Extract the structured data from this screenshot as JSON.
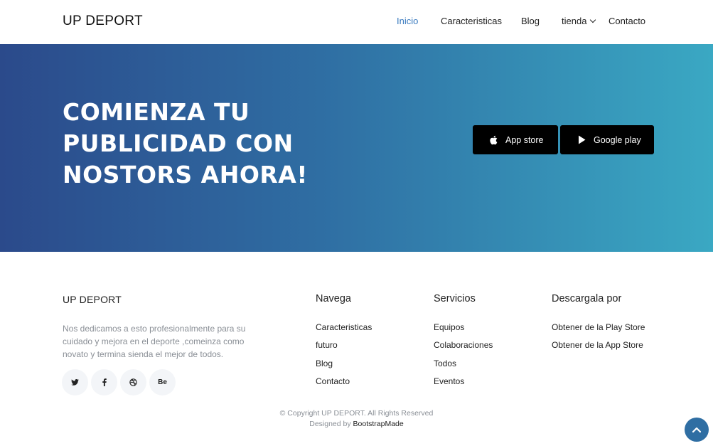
{
  "header": {
    "brand": "UP DEPORT",
    "nav": [
      {
        "label": "Inicio"
      },
      {
        "label": "Caracteristicas"
      },
      {
        "label": "Blog"
      },
      {
        "label": "tienda"
      },
      {
        "label": "Contacto"
      }
    ],
    "active_color": "#3b7bbf"
  },
  "hero": {
    "title": "COMIENZA TU PUBLICIDAD CON NOSTORS AHORA!",
    "buttons": {
      "app_store": {
        "label": "App store",
        "icon": "apple-icon"
      },
      "google_play": {
        "label": "Google play",
        "icon": "play-icon"
      }
    },
    "gradient": [
      "#2b4a8b",
      "#3aa8c3"
    ]
  },
  "footer": {
    "brand": "UP DEPORT",
    "description": "Nos dedicamos a esto profesionalmente para su cuidado y mejora en el deporte ,comeinza como novato y termina sienda el mejor de todos.",
    "socials": [
      {
        "icon": "twitter-icon"
      },
      {
        "icon": "facebook-icon"
      },
      {
        "icon": "dribbble-icon"
      },
      {
        "icon": "behance-icon",
        "text": "Be"
      }
    ],
    "columns": [
      {
        "title": "Navega",
        "items": [
          "Caracteristicas",
          "futuro",
          "Blog",
          "Contacto"
        ]
      },
      {
        "title": "Servicios",
        "items": [
          "Equipos",
          "Colaboraciones",
          "Todos",
          "Eventos"
        ]
      },
      {
        "title": "Descargala por",
        "items": [
          "Obtener de la Play Store",
          "Obtener de la App Store"
        ]
      }
    ],
    "copyright": "© Copyright UP DEPORT. All Rights Reserved",
    "designed_by_prefix": "Designed by",
    "designed_by_name": "BootstrapMade"
  },
  "back_to_top": {
    "icon": "chevron-up-icon",
    "color": "#2f6ea3"
  }
}
